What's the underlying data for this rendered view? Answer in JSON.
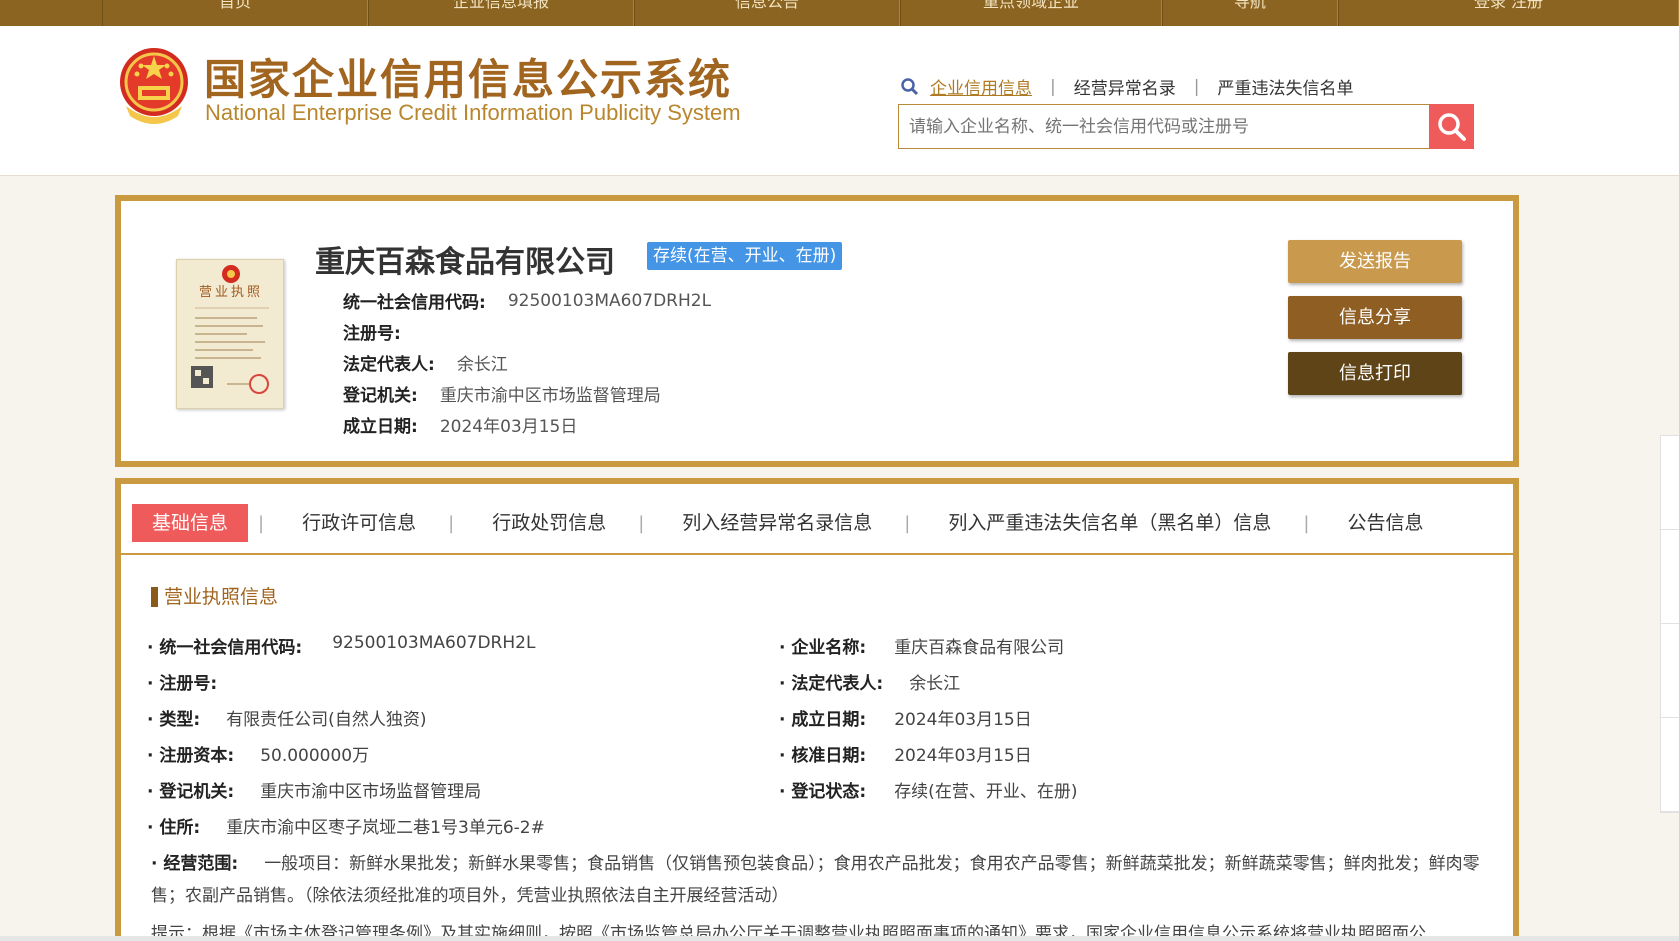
{
  "topnav": {
    "items": [
      "首页",
      "企业信息填报",
      "信息公告",
      "重点领域企业",
      "导航",
      "登录 注册"
    ]
  },
  "header": {
    "title_cn": "国家企业信用信息公示系统",
    "title_en": "National Enterprise Credit Information Publicity System",
    "search_tabs": [
      "企业信用信息",
      "经营异常名录",
      "严重违法失信名单"
    ],
    "search_placeholder": "请输入企业名称、统一社会信用代码或注册号"
  },
  "company": {
    "name": "重庆百森食品有限公司",
    "status": "存续(在营、开业、在册)",
    "rows": [
      {
        "label": "统一社会信用代码:",
        "value": "92500103MA607DRH2L"
      },
      {
        "label": "注册号:",
        "value": ""
      },
      {
        "label": "法定代表人:",
        "value": "余长江"
      },
      {
        "label": "登记机关:",
        "value": "重庆市渝中区市场监督管理局"
      },
      {
        "label": "成立日期:",
        "value": "2024年03月15日"
      }
    ],
    "buttons": {
      "send_report": "发送报告",
      "share": "信息分享",
      "print": "信息打印"
    },
    "license_text": "营业执照"
  },
  "tabs": [
    "基础信息",
    "行政许可信息",
    "行政处罚信息",
    "列入经营异常名录信息",
    "列入严重违法失信名单（黑名单）信息",
    "公告信息"
  ],
  "detail": {
    "section_title": "营业执照信息",
    "left": [
      {
        "label": "· 统一社会信用代码:",
        "value": "92500103MA607DRH2L"
      },
      {
        "label": "· 注册号:",
        "value": ""
      },
      {
        "label": "· 类型:",
        "value": "有限责任公司(自然人独资)"
      },
      {
        "label": "· 注册资本:",
        "value": "50.000000万"
      },
      {
        "label": "· 登记机关:",
        "value": "重庆市渝中区市场监督管理局"
      },
      {
        "label": "· 住所:",
        "value": "重庆市渝中区枣子岚垭二巷1号3单元6-2#"
      }
    ],
    "right": [
      {
        "label": "· 企业名称:",
        "value": "重庆百森食品有限公司"
      },
      {
        "label": "· 法定代表人:",
        "value": "余长江"
      },
      {
        "label": "· 成立日期:",
        "value": "2024年03月15日"
      },
      {
        "label": "· 核准日期:",
        "value": "2024年03月15日"
      },
      {
        "label": "· 登记状态:",
        "value": "存续(在营、开业、在册)"
      }
    ],
    "scope_label": "· 经营范围:",
    "scope_value": "一般项目：新鲜水果批发；新鲜水果零售；食品销售（仅销售预包装食品）；食用农产品批发；食用农产品零售；新鲜蔬菜批发；新鲜蔬菜零售；鲜肉批发；鲜肉零售；农副产品销售。（除依法须经批准的项目外，凭营业执照依法自主开展经营活动）",
    "notice": "提示：根据《市场主体登记管理条例》及其实施细则，按照《市场监管总局办公厅关于调整营业执照照面事项的通知》要求，国家企业信用信息公示系统将营业执照照面公"
  },
  "colors": {
    "gold": "#c99a3f",
    "brown": "#8a6420",
    "red": "#ef5b5b",
    "blue": "#4595e6"
  }
}
